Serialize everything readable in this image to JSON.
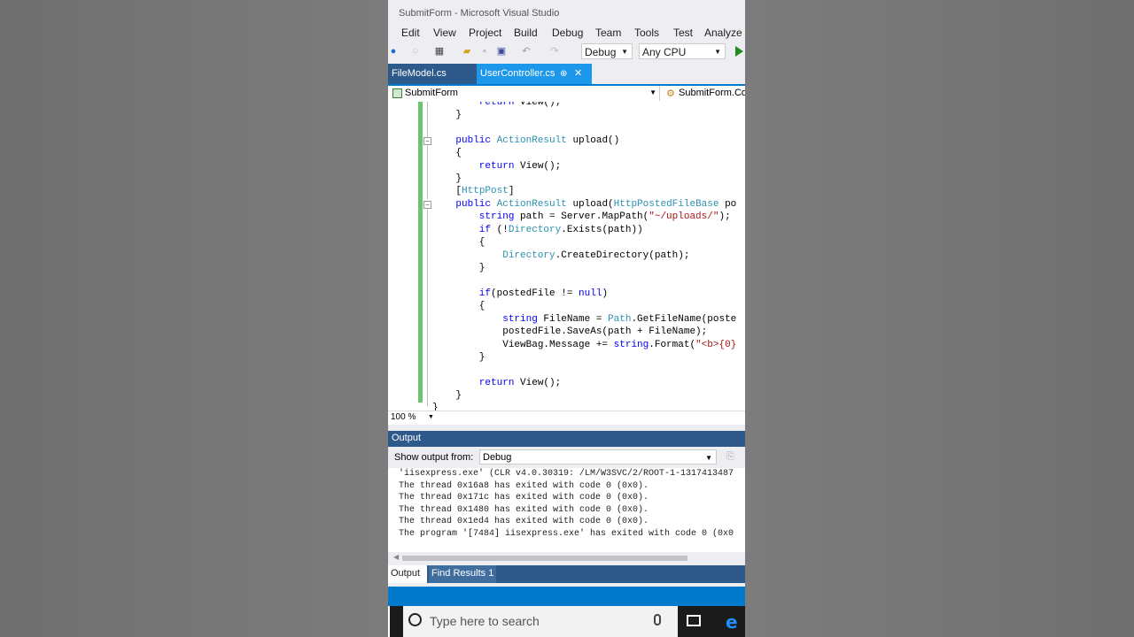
{
  "window": {
    "title": "SubmitForm - Microsoft Visual Studio"
  },
  "menu": [
    "Edit",
    "View",
    "Project",
    "Build",
    "Debug",
    "Team",
    "Tools",
    "Test",
    "Analyze"
  ],
  "toolbar": {
    "config": "Debug",
    "platform": "Any CPU"
  },
  "tabs": [
    {
      "label": "FileModel.cs",
      "active": false
    },
    {
      "label": "UserController.cs",
      "active": true
    }
  ],
  "nav": {
    "project": "SubmitForm",
    "class": "SubmitForm.Co"
  },
  "code_lines": [
    "        return View();",
    "    }",
    "",
    "    public ActionResult upload()",
    "    {",
    "        return View();",
    "    }",
    "    [HttpPost]",
    "    public ActionResult upload(HttpPostedFileBase po",
    "        string path = Server.MapPath(\"~/uploads/\");",
    "        if (!Directory.Exists(path))",
    "        {",
    "            Directory.CreateDirectory(path);",
    "        }",
    "",
    "        if(postedFile != null)",
    "        {",
    "            string FileName = Path.GetFileName(poste",
    "            postedFile.SaveAs(path + FileName);",
    "            ViewBag.Message += string.Format(\"<b>{0}",
    "        }",
    "",
    "        return View();",
    "    }",
    "}"
  ],
  "zoom": "100 %",
  "output": {
    "title": "Output",
    "show_from_label": "Show output from:",
    "show_from_value": "Debug",
    "lines": [
      "'iisexpress.exe' (CLR v4.0.30319: /LM/W3SVC/2/ROOT-1-1317413487",
      "The thread 0x16a8 has exited with code 0 (0x0).",
      "The thread 0x171c has exited with code 0 (0x0).",
      "The thread 0x1480 has exited with code 0 (0x0).",
      "The thread 0x1ed4 has exited with code 0 (0x0).",
      "The program '[7484] iisexpress.exe' has exited with code 0 (0x0"
    ]
  },
  "bottom_tabs": [
    "Output",
    "Find Results 1"
  ],
  "taskbar": {
    "search_placeholder": "Type here to search"
  },
  "colors": {
    "accent": "#007acc",
    "tab_active": "#1c97ea",
    "change_bar": "#6ec36e"
  }
}
